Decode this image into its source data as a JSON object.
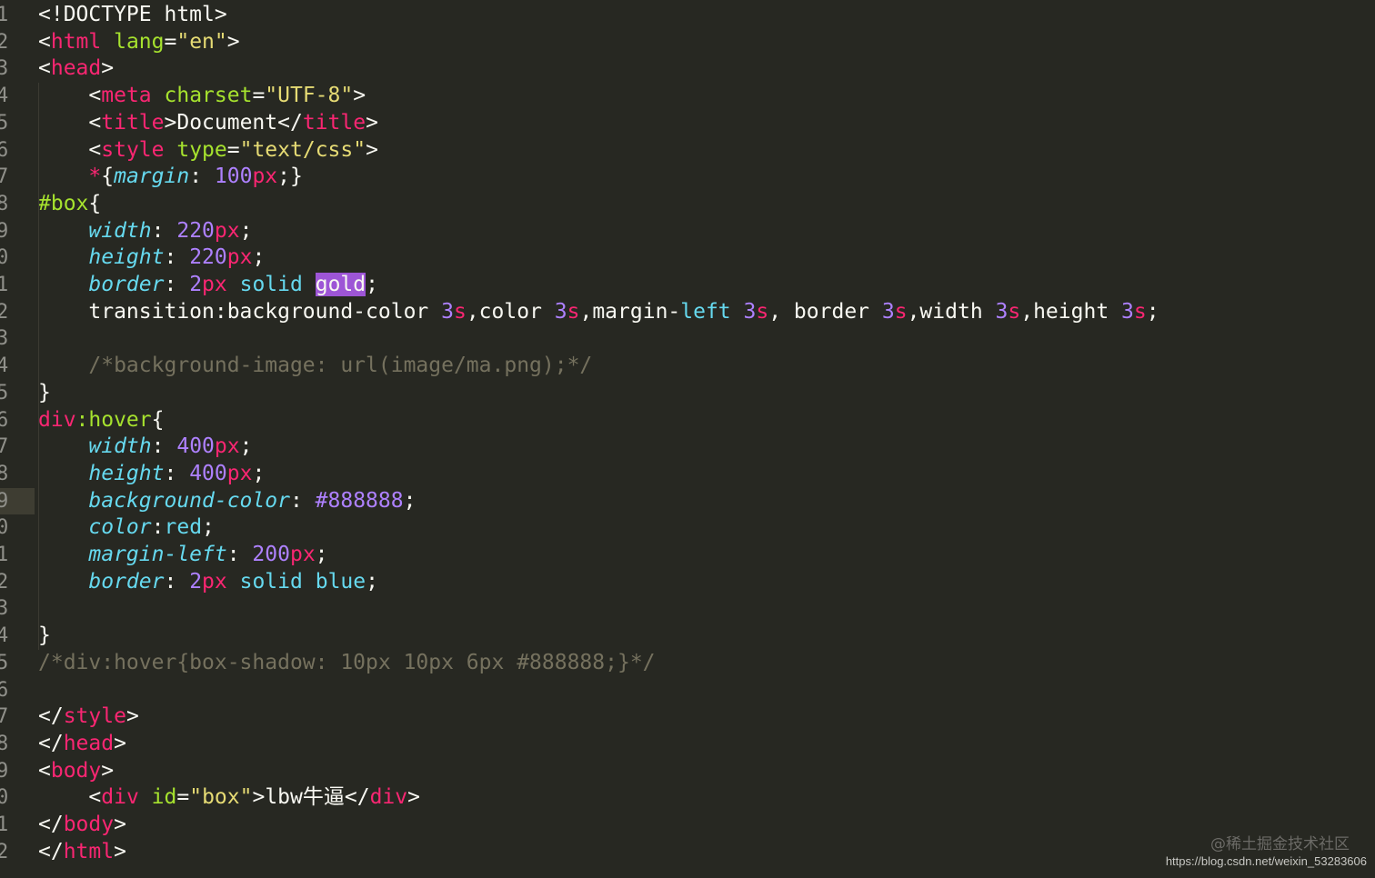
{
  "editor": {
    "theme_colors": {
      "background": "#272822",
      "tag": "#f92672",
      "attribute": "#a6e22e",
      "string": "#e6db74",
      "property": "#66d9ef",
      "number": "#ae81ff",
      "comment": "#75715e",
      "highlight": "#9d55d6"
    },
    "active_line": 19,
    "lines": [
      {
        "n": "1",
        "tokens": [
          [
            "tk-default",
            "<!DOCTYPE html>"
          ]
        ]
      },
      {
        "n": "2",
        "tokens": [
          [
            "tk-default",
            "<"
          ],
          [
            "tk-tag",
            "html"
          ],
          [
            "tk-default",
            " "
          ],
          [
            "tk-attr",
            "lang"
          ],
          [
            "tk-default",
            "="
          ],
          [
            "tk-string",
            "\"en\""
          ],
          [
            "tk-default",
            ">"
          ]
        ]
      },
      {
        "n": "3",
        "tokens": [
          [
            "tk-default",
            "<"
          ],
          [
            "tk-tag",
            "head"
          ],
          [
            "tk-default",
            ">"
          ]
        ]
      },
      {
        "n": "4",
        "tokens": [
          [
            "tk-default",
            "    <"
          ],
          [
            "tk-tag",
            "meta"
          ],
          [
            "tk-default",
            " "
          ],
          [
            "tk-attr",
            "charset"
          ],
          [
            "tk-default",
            "="
          ],
          [
            "tk-string",
            "\"UTF-8\""
          ],
          [
            "tk-default",
            ">"
          ]
        ]
      },
      {
        "n": "5",
        "tokens": [
          [
            "tk-default",
            "    <"
          ],
          [
            "tk-tag",
            "title"
          ],
          [
            "tk-default",
            ">Document</"
          ],
          [
            "tk-tag",
            "title"
          ],
          [
            "tk-default",
            ">"
          ]
        ]
      },
      {
        "n": "6",
        "tokens": [
          [
            "tk-default",
            "    <"
          ],
          [
            "tk-tag",
            "style"
          ],
          [
            "tk-default",
            " "
          ],
          [
            "tk-attr",
            "type"
          ],
          [
            "tk-default",
            "="
          ],
          [
            "tk-string",
            "\"text/css\""
          ],
          [
            "tk-default",
            ">"
          ]
        ]
      },
      {
        "n": "7",
        "tokens": [
          [
            "tk-default",
            "    "
          ],
          [
            "tk-star",
            "*"
          ],
          [
            "tk-default",
            "{"
          ],
          [
            "tk-prop",
            "margin"
          ],
          [
            "tk-default",
            ": "
          ],
          [
            "tk-number",
            "100"
          ],
          [
            "tk-unit",
            "px"
          ],
          [
            "tk-default",
            ";}"
          ]
        ]
      },
      {
        "n": "8",
        "tokens": [
          [
            "tk-selector",
            "#box"
          ],
          [
            "tk-default",
            "{"
          ]
        ]
      },
      {
        "n": "9",
        "tokens": [
          [
            "tk-default",
            "    "
          ],
          [
            "tk-prop",
            "width"
          ],
          [
            "tk-default",
            ": "
          ],
          [
            "tk-number",
            "220"
          ],
          [
            "tk-unit",
            "px"
          ],
          [
            "tk-default",
            ";"
          ]
        ]
      },
      {
        "n": "0",
        "tokens": [
          [
            "tk-default",
            "    "
          ],
          [
            "tk-prop",
            "height"
          ],
          [
            "tk-default",
            ": "
          ],
          [
            "tk-number",
            "220"
          ],
          [
            "tk-unit",
            "px"
          ],
          [
            "tk-default",
            ";"
          ]
        ]
      },
      {
        "n": "1",
        "tokens": [
          [
            "tk-default",
            "    "
          ],
          [
            "tk-prop",
            "border"
          ],
          [
            "tk-default",
            ": "
          ],
          [
            "tk-number",
            "2"
          ],
          [
            "tk-unit",
            "px"
          ],
          [
            "tk-default",
            " "
          ],
          [
            "tk-keyword",
            "solid"
          ],
          [
            "tk-default",
            " "
          ],
          [
            "tk-highlight",
            "gold"
          ],
          [
            "tk-default",
            ";"
          ]
        ]
      },
      {
        "n": "2",
        "tokens": [
          [
            "tk-default",
            "    transition:background-color "
          ],
          [
            "tk-number",
            "3"
          ],
          [
            "tk-unit",
            "s"
          ],
          [
            "tk-default",
            ",color "
          ],
          [
            "tk-number",
            "3"
          ],
          [
            "tk-unit",
            "s"
          ],
          [
            "tk-default",
            ",margin-"
          ],
          [
            "tk-keyword",
            "left"
          ],
          [
            "tk-default",
            " "
          ],
          [
            "tk-number",
            "3"
          ],
          [
            "tk-unit",
            "s"
          ],
          [
            "tk-default",
            ", border "
          ],
          [
            "tk-number",
            "3"
          ],
          [
            "tk-unit",
            "s"
          ],
          [
            "tk-default",
            ",width "
          ],
          [
            "tk-number",
            "3"
          ],
          [
            "tk-unit",
            "s"
          ],
          [
            "tk-default",
            ",height "
          ],
          [
            "tk-number",
            "3"
          ],
          [
            "tk-unit",
            "s"
          ],
          [
            "tk-default",
            ";"
          ]
        ]
      },
      {
        "n": "3",
        "tokens": []
      },
      {
        "n": "4",
        "tokens": [
          [
            "tk-comment",
            "    /*background-image: url(image/ma.png);*/"
          ]
        ]
      },
      {
        "n": "5",
        "tokens": [
          [
            "tk-default",
            "}"
          ]
        ]
      },
      {
        "n": "6",
        "tokens": [
          [
            "tk-tag",
            "div"
          ],
          [
            "tk-pseudo",
            ":hover"
          ],
          [
            "tk-default",
            "{"
          ]
        ]
      },
      {
        "n": "7",
        "tokens": [
          [
            "tk-default",
            "    "
          ],
          [
            "tk-prop",
            "width"
          ],
          [
            "tk-default",
            ": "
          ],
          [
            "tk-number",
            "400"
          ],
          [
            "tk-unit",
            "px"
          ],
          [
            "tk-default",
            ";"
          ]
        ]
      },
      {
        "n": "8",
        "tokens": [
          [
            "tk-default",
            "    "
          ],
          [
            "tk-prop",
            "height"
          ],
          [
            "tk-default",
            ": "
          ],
          [
            "tk-number",
            "400"
          ],
          [
            "tk-unit",
            "px"
          ],
          [
            "tk-default",
            ";"
          ]
        ]
      },
      {
        "n": "9",
        "tokens": [
          [
            "tk-default",
            "    "
          ],
          [
            "tk-prop",
            "background-color"
          ],
          [
            "tk-default",
            ": "
          ],
          [
            "tk-number",
            "#888888"
          ],
          [
            "tk-default",
            ";"
          ]
        ]
      },
      {
        "n": "0",
        "tokens": [
          [
            "tk-default",
            "    "
          ],
          [
            "tk-prop",
            "color"
          ],
          [
            "tk-default",
            ":"
          ],
          [
            "tk-keyword",
            "red"
          ],
          [
            "tk-default",
            ";"
          ]
        ]
      },
      {
        "n": "1",
        "tokens": [
          [
            "tk-default",
            "    "
          ],
          [
            "tk-prop",
            "margin-left"
          ],
          [
            "tk-default",
            ": "
          ],
          [
            "tk-number",
            "200"
          ],
          [
            "tk-unit",
            "px"
          ],
          [
            "tk-default",
            ";"
          ]
        ]
      },
      {
        "n": "2",
        "tokens": [
          [
            "tk-default",
            "    "
          ],
          [
            "tk-prop",
            "border"
          ],
          [
            "tk-default",
            ": "
          ],
          [
            "tk-number",
            "2"
          ],
          [
            "tk-unit",
            "px"
          ],
          [
            "tk-default",
            " "
          ],
          [
            "tk-keyword",
            "solid"
          ],
          [
            "tk-default",
            " "
          ],
          [
            "tk-keyword",
            "blue"
          ],
          [
            "tk-default",
            ";"
          ]
        ]
      },
      {
        "n": "3",
        "tokens": []
      },
      {
        "n": "4",
        "tokens": [
          [
            "tk-default",
            "}"
          ]
        ]
      },
      {
        "n": "5",
        "tokens": [
          [
            "tk-comment",
            "/*div:hover{box-shadow: 10px 10px 6px #888888;}*/"
          ]
        ]
      },
      {
        "n": "6",
        "tokens": []
      },
      {
        "n": "7",
        "tokens": [
          [
            "tk-default",
            "</"
          ],
          [
            "tk-tag",
            "style"
          ],
          [
            "tk-default",
            ">"
          ]
        ]
      },
      {
        "n": "8",
        "tokens": [
          [
            "tk-default",
            "</"
          ],
          [
            "tk-tag",
            "head"
          ],
          [
            "tk-default",
            ">"
          ]
        ]
      },
      {
        "n": "9",
        "tokens": [
          [
            "tk-default",
            "<"
          ],
          [
            "tk-tag",
            "body"
          ],
          [
            "tk-default",
            ">"
          ]
        ]
      },
      {
        "n": "0",
        "tokens": [
          [
            "tk-default",
            "    <"
          ],
          [
            "tk-tag",
            "div"
          ],
          [
            "tk-default",
            " "
          ],
          [
            "tk-attr",
            "id"
          ],
          [
            "tk-default",
            "="
          ],
          [
            "tk-string",
            "\"box\""
          ],
          [
            "tk-default",
            ">lbw牛逼</"
          ],
          [
            "tk-tag",
            "div"
          ],
          [
            "tk-default",
            ">"
          ]
        ]
      },
      {
        "n": "1",
        "tokens": [
          [
            "tk-default",
            "</"
          ],
          [
            "tk-tag",
            "body"
          ],
          [
            "tk-default",
            ">"
          ]
        ]
      },
      {
        "n": "2",
        "tokens": [
          [
            "tk-default",
            "</"
          ],
          [
            "tk-tag",
            "html"
          ],
          [
            "tk-default",
            ">"
          ]
        ]
      }
    ]
  },
  "watermark": {
    "brand": "@稀土掘金技术社区",
    "url": "https://blog.csdn.net/weixin_53283606"
  }
}
